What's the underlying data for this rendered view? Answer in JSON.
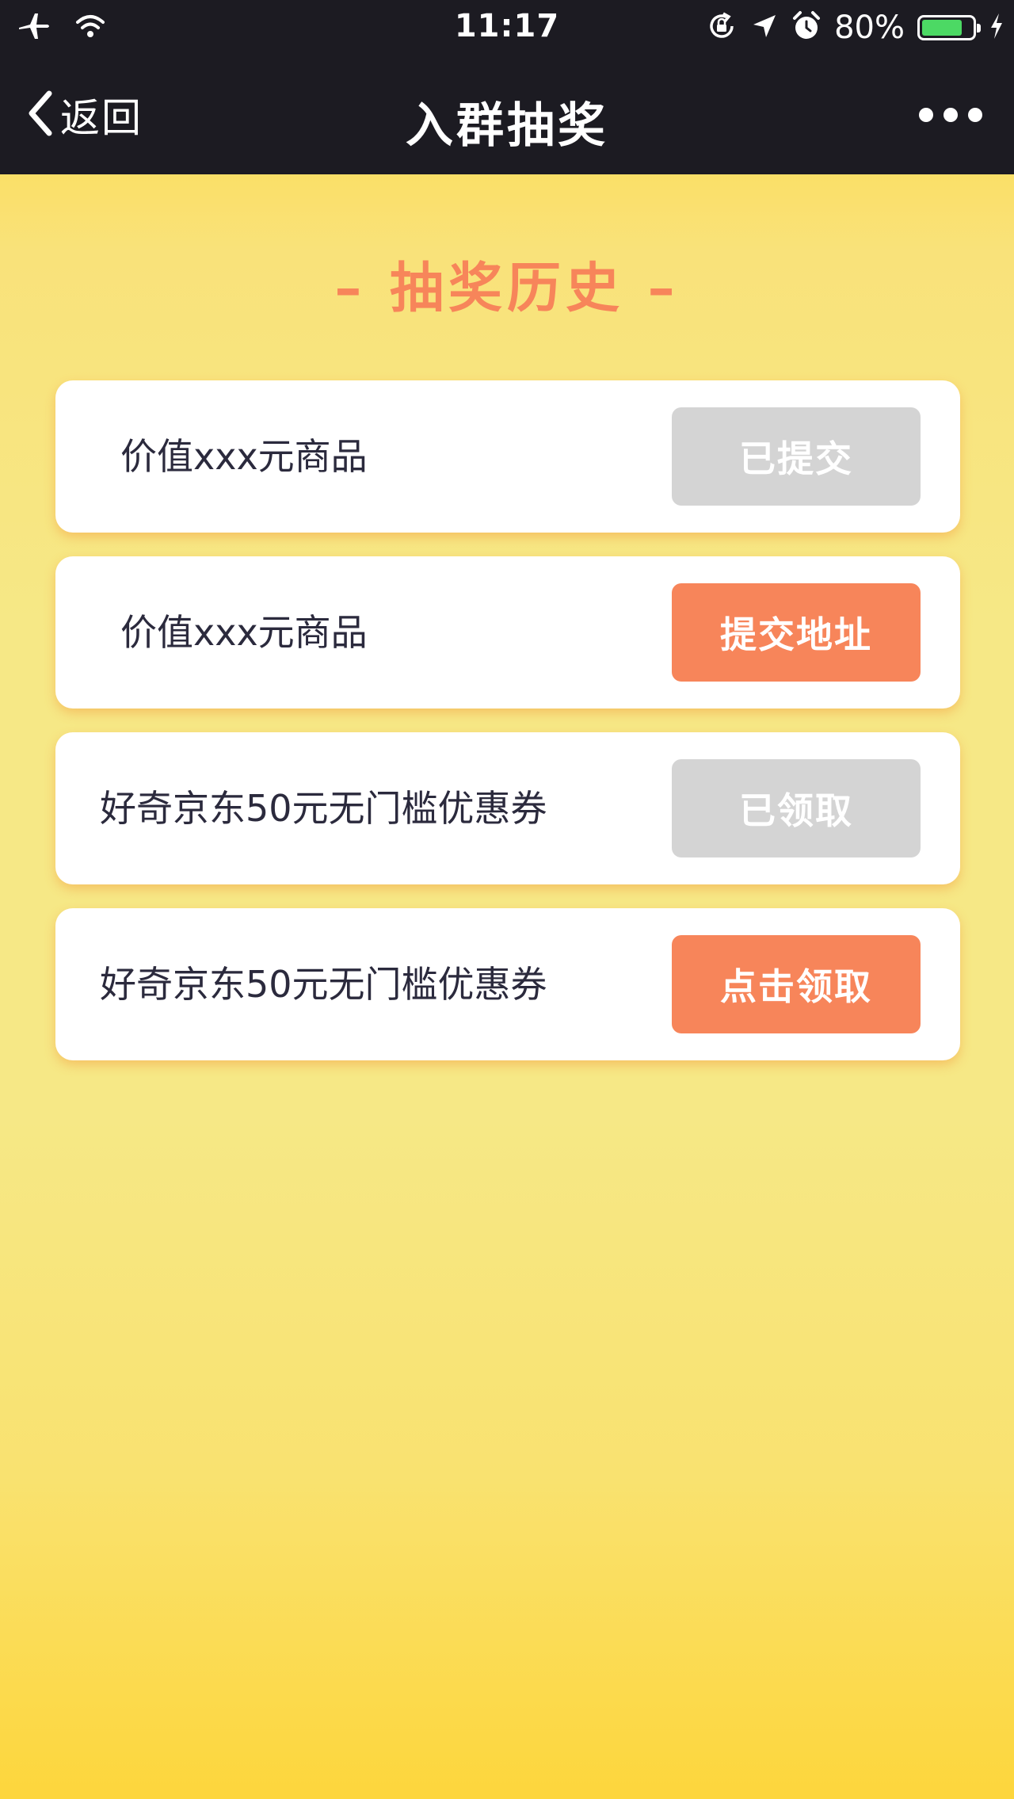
{
  "status_bar": {
    "time": "11:17",
    "battery_percent": "80%",
    "battery_level": 0.8,
    "icons": [
      "airplane-icon",
      "wifi-icon",
      "rotation-lock-icon",
      "location-icon",
      "alarm-icon",
      "battery-icon",
      "charging-icon"
    ]
  },
  "nav": {
    "back_label": "返回",
    "title": "入群抽奖",
    "more_icon": "more-icon"
  },
  "section": {
    "title": "– 抽奖历史 –"
  },
  "records": [
    {
      "label": "价值xxx元商品",
      "button": "已提交",
      "state": "disabled"
    },
    {
      "label": "价值xxx元商品",
      "button": "提交地址",
      "state": "active"
    },
    {
      "label": "好奇京东50元无门槛优惠券",
      "button": "已领取",
      "state": "disabled"
    },
    {
      "label": "好奇京东50元无门槛优惠券",
      "button": "点击领取",
      "state": "active"
    }
  ],
  "colors": {
    "accent": "#f7855a",
    "disabled": "#d4d4d4",
    "bar": "#1c1b22",
    "battery": "#4cd964"
  }
}
